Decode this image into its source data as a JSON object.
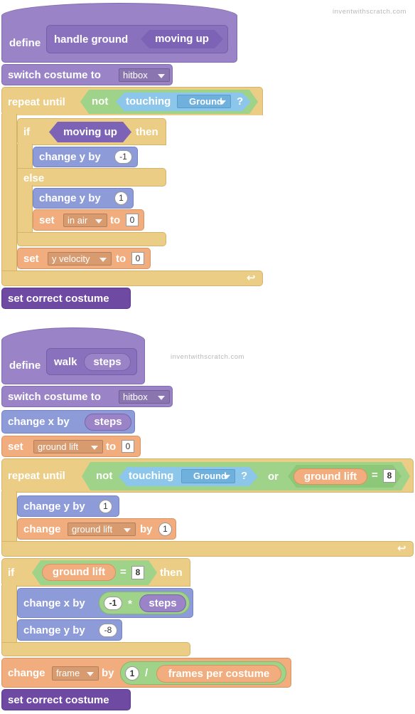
{
  "watermark_text": "inventwithscratch.com",
  "script1": {
    "define_label": "define",
    "block_name": "handle ground",
    "param": "moving up",
    "switch_costume_label": "switch costume to",
    "switch_costume_value": "hitbox",
    "repeat_until_label": "repeat until",
    "not_label": "not",
    "touching_label": "touching",
    "touching_value": "Ground",
    "question_mark": "?",
    "if_label": "if",
    "if_condition": "moving up",
    "then_label": "then",
    "change_y_label": "change y by",
    "change_y_value_1": "-1",
    "else_label": "else",
    "change_y_value_2": "1",
    "set_label": "set",
    "set_var_1": "in air",
    "to_label": "to",
    "set_value_1": "0",
    "set_var_2": "y velocity",
    "set_value_2": "0",
    "loop_icon": "loop-arrow-icon",
    "final_block": "set correct costume"
  },
  "script2": {
    "define_label": "define",
    "block_name": "walk",
    "param": "steps",
    "switch_costume_label": "switch costume to",
    "switch_costume_value": "hitbox",
    "change_x_label": "change x by",
    "change_x_param": "steps",
    "set_label": "set",
    "set_var": "ground lift",
    "to_label": "to",
    "set_value": "0",
    "repeat_until_label": "repeat until",
    "not_label": "not",
    "touching_label": "touching",
    "touching_value": "Ground",
    "question_mark": "?",
    "or_label": "or",
    "ground_lift_reporter": "ground lift",
    "equals": "=",
    "equals_value": "8",
    "change_y_label": "change y by",
    "change_y_value_1": "1",
    "change_label": "change",
    "change_var": "ground lift",
    "by_label": "by",
    "change_value": "1",
    "loop_icon": "loop-arrow-icon",
    "if_label": "if",
    "if_reporter": "ground lift",
    "if_equals": "=",
    "if_value": "8",
    "then_label": "then",
    "change_x2_label": "change x by",
    "mult_value": "-1",
    "mult_sym": "*",
    "mult_param": "steps",
    "change_y2_label": "change y by",
    "change_y_value_2": "-8",
    "change_frame_label": "change",
    "frame_var": "frame",
    "frame_by_label": "by",
    "div_value": "1",
    "div_sym": "/",
    "frames_per_costume": "frames per costume",
    "final_block": "set correct costume"
  },
  "colors": {
    "custom_block": "#9a83c6",
    "motion": "#8d9bd9",
    "looks": "#9a83c6",
    "data": "#f1ad7d",
    "control": "#ebcd86",
    "operators": "#9fd389",
    "sensing": "#8cc6ea",
    "custom_call": "#6f4aa3"
  }
}
